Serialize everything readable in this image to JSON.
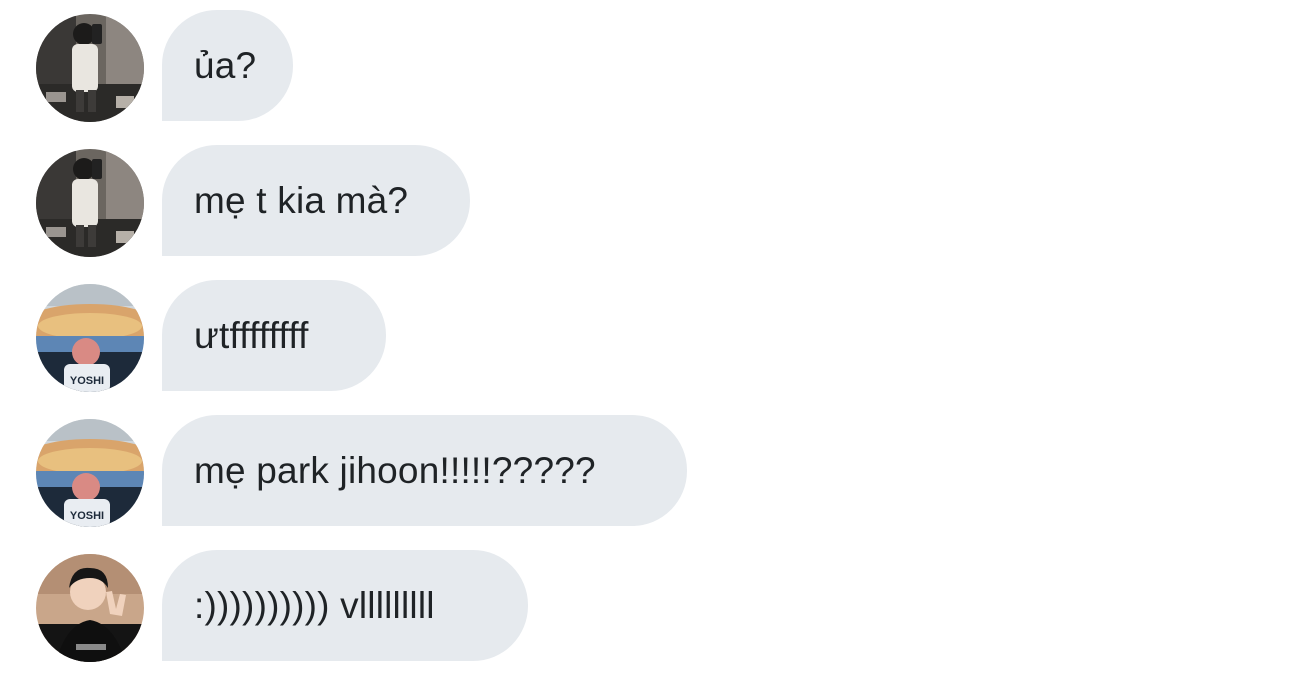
{
  "messages": [
    {
      "text": "ủa?",
      "avatar": "mirror-selfie-avatar"
    },
    {
      "text": "mẹ t kia mà?",
      "avatar": "mirror-selfie-avatar"
    },
    {
      "text": "ưtffffffff",
      "avatar": "stadium-avatar"
    },
    {
      "text": "mẹ park jihoon!!!!!?????",
      "avatar": "stadium-avatar"
    },
    {
      "text": ":)))))))))) vlllllllll",
      "avatar": "peace-sign-avatar"
    }
  ],
  "avatar_text": {
    "jersey": "YOSHI"
  },
  "colors": {
    "bubble": "#e6eaee",
    "text": "#1f2326",
    "background": "#ffffff"
  }
}
